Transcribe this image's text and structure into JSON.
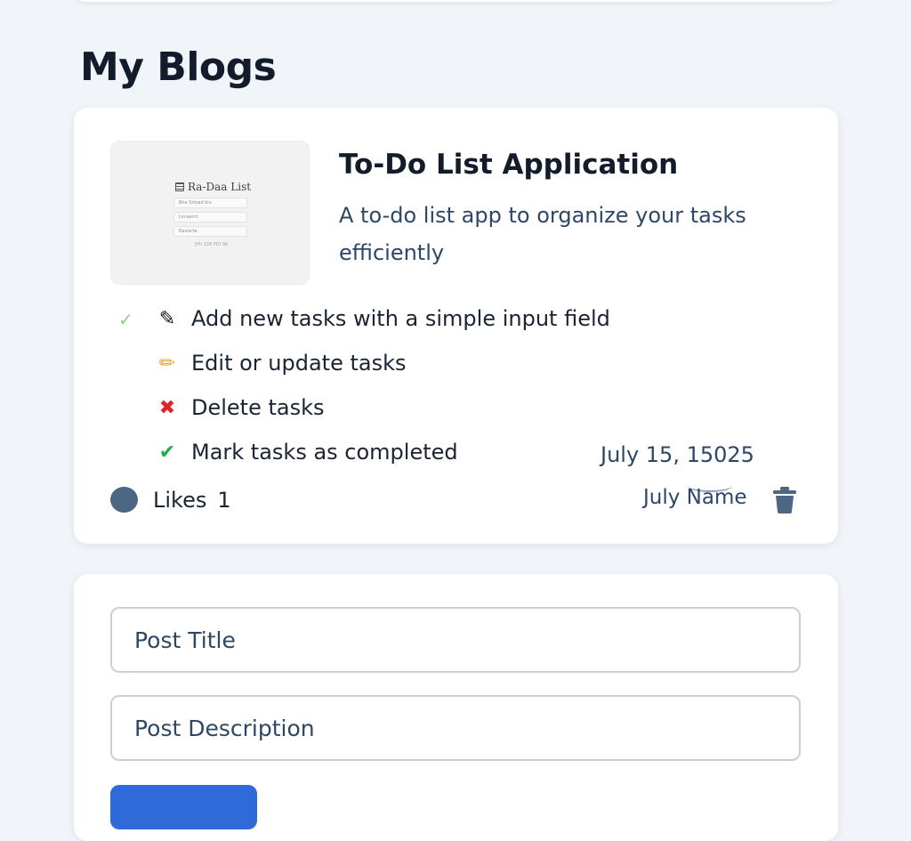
{
  "page": {
    "heading": "My Blogs"
  },
  "blog": {
    "title": "To-Do List Application",
    "description": "A to-do list app to organize your tasks efficiently",
    "thumbnail": {
      "title": "Ra-Daa List",
      "rows": [
        "Bhe Srtoad kiu",
        "Lirraanrt",
        "Rasiarte"
      ],
      "footer": "[Ph 128 PDi 06"
    },
    "features": [
      {
        "icon": "pen-icon",
        "text": "Add new tasks with a simple input field"
      },
      {
        "icon": "pencil-icon",
        "text": "Edit or update tasks"
      },
      {
        "icon": "cross-mark-icon",
        "text": "Delete tasks"
      },
      {
        "icon": "check-mark-icon",
        "text": "Mark tasks as completed"
      }
    ],
    "date": "July 15, 15025",
    "likes_label": "Likes",
    "likes_count": "1",
    "author": "July Name"
  },
  "form": {
    "title_placeholder": "Post Title",
    "description_placeholder": "Post Description",
    "submit_label": ""
  },
  "colors": {
    "background": "#f1f4f9",
    "card": "#ffffff",
    "heading": "#141c2b",
    "muted_text": "#2d4767",
    "primary_button": "#2f6ad9"
  }
}
